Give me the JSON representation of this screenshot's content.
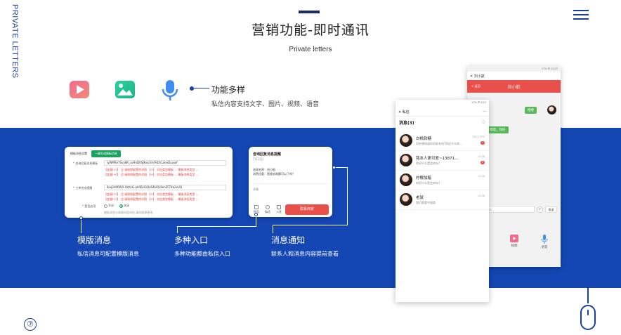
{
  "page": {
    "side_title": "PRIVATE LETTERS",
    "title": "营销功能-即时通讯",
    "subtitle": "Private letters",
    "page_number": "⑦"
  },
  "feature": {
    "title": "功能多样",
    "desc": "私信内容支持文字、图片、视频、语音",
    "icons": [
      "video-icon",
      "image-icon",
      "microphone-icon"
    ]
  },
  "template_card": {
    "tab_label": "模板消息设置",
    "button_label": "一键生成模板消息",
    "row1_label": "* 咨询回复消息模板",
    "row1_value": "iyWMRe7Svy8R_ov9nDRSJKwcVmfHLYCuIeeDuuwY",
    "row1_red": "【变量(+)】 注:请按照配置的对照 【+】 对应类型模板 ... 模板消息类型 ...",
    "row2_label": "* 工单完成提醒",
    "row2_value": "8vq2d4R0l0-OzhhG-pk0EkIGQaS4HOL9enZFTKa2eUQ",
    "row2_red": "【变量(+)】 注:请按照配置的对照 【+】 对应类型模板 ... 模板消息类型 ...",
    "switch_label": "* 是否启用",
    "option_on": "开启",
    "option_off": "关闭",
    "note": "模板消息与表格内容对应,请勿随意更改"
  },
  "notice_card": {
    "title": "咨询回复消息提醒",
    "time": "7月21日",
    "line1": "咨询名称：刘小航",
    "line2": "消息回复：直接去啥都可以了吗？",
    "detail": "详情"
  },
  "entry_tabs": {
    "tabs": [
      "首页",
      "私信",
      "入驻"
    ],
    "red_button": "联系商家"
  },
  "labels": [
    {
      "title": "模版消息",
      "desc": "私信消息可配置模版消息"
    },
    {
      "title": "多种入口",
      "desc": "多种功能都由私信入口"
    },
    {
      "title": "消息通知",
      "desc": "联系人和消息内容提前查看"
    }
  ],
  "chat_phone": {
    "status": "17% ☰ 12:07",
    "head_icon": "close-icon",
    "back": "< 返回",
    "name": "刘小航",
    "bubble1": "哈喽",
    "bubble2": "嗯嗯，你好",
    "input_placeholder": "输入...",
    "send": "发送",
    "tools": [
      "视频",
      "语音"
    ]
  },
  "list_phone": {
    "status": "17% ☰ 4:12",
    "header": "私信",
    "subheader": "消息(3)",
    "items": [
      {
        "name": "白桃软糖",
        "msg": "你好想知道你的联系吗?你好什么样...",
        "time": "7月12 中午",
        "badge": "1"
      },
      {
        "name": "我本人更可爱~13871...",
        "msg": "你好什么是会的吗?",
        "time": "14:38",
        "badge": "1"
      },
      {
        "name": "柠檬加醋",
        "msg": "你好什么是会的吗?",
        "time": "14:38",
        "badge": ""
      },
      {
        "name": "老鼠",
        "msg": "我们都要中国商",
        "time": "14:38",
        "badge": ""
      }
    ]
  },
  "colors": {
    "band": "#1446b4",
    "accent": "#1a3fa0",
    "red": "#e9504b",
    "green": "#5cb85c"
  }
}
